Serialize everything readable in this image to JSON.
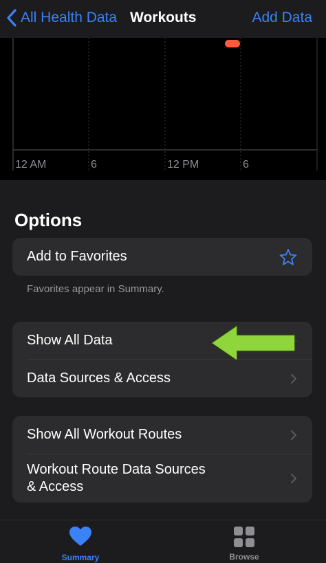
{
  "navbar": {
    "back_label": "All Health Data",
    "title": "Workouts",
    "add_label": "Add Data"
  },
  "chart": {
    "x_labels": [
      "12 AM",
      "6",
      "12 PM",
      "6"
    ],
    "marker_color": "#ff5a3c"
  },
  "options": {
    "heading": "Options",
    "favorites_label": "Add to Favorites",
    "favorites_footnote": "Favorites appear in Summary.",
    "show_all_data": "Show All Data",
    "data_sources": "Data Sources & Access",
    "show_routes": "Show All Workout Routes",
    "route_sources_line1": "Workout Route Data Sources",
    "route_sources_line2": "& Access"
  },
  "tabbar": {
    "summary_label": "Summary",
    "browse_label": "Browse"
  },
  "colors": {
    "accent": "#3a82f7",
    "annotation_arrow": "#8ed63b"
  },
  "icons": [
    "chevron-left-icon",
    "star-icon",
    "chevron-right-icon",
    "heart-icon",
    "grid-icon",
    "arrow-annotation"
  ]
}
